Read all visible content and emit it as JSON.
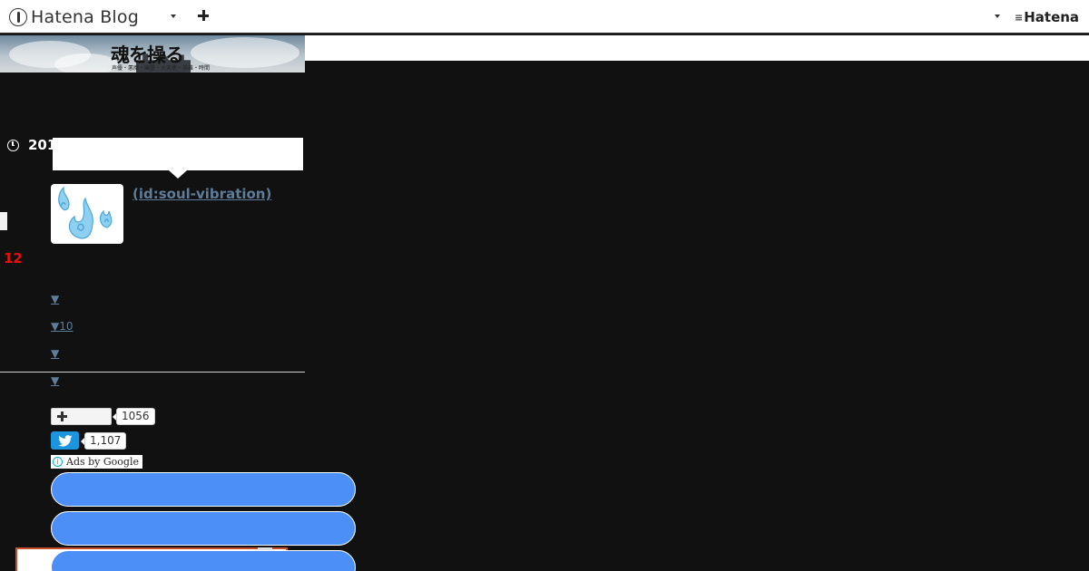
{
  "topbar": {
    "logo_text": "Hatena Blog",
    "brand_text": "Hatena",
    "icons": [
      "logo-icon",
      "chevron-down-icon",
      "plus-icon",
      "chevron-down-icon"
    ]
  },
  "header": {
    "title_art": "魂を操る",
    "sub_art": "声優・悪魔・幽霊・大天使・英雄・時間"
  },
  "entry": {
    "date_prefix": "201",
    "author_link": " (id:soul-vibration)",
    "red_number": "12"
  },
  "archive": {
    "items": [
      "▼",
      "▼10",
      "▼",
      "▼"
    ]
  },
  "share": {
    "hatena_bookmark_count": "1056",
    "twitter_count": "1,107"
  },
  "ads": {
    "label": "Ads by Google",
    "info_glyph": "i"
  },
  "colors": {
    "background": "#111111",
    "link": "#5e7d9a",
    "accent_red": "#e8100f",
    "ad_pill": "#4c8ff6",
    "twitter": "#1b95e0"
  }
}
